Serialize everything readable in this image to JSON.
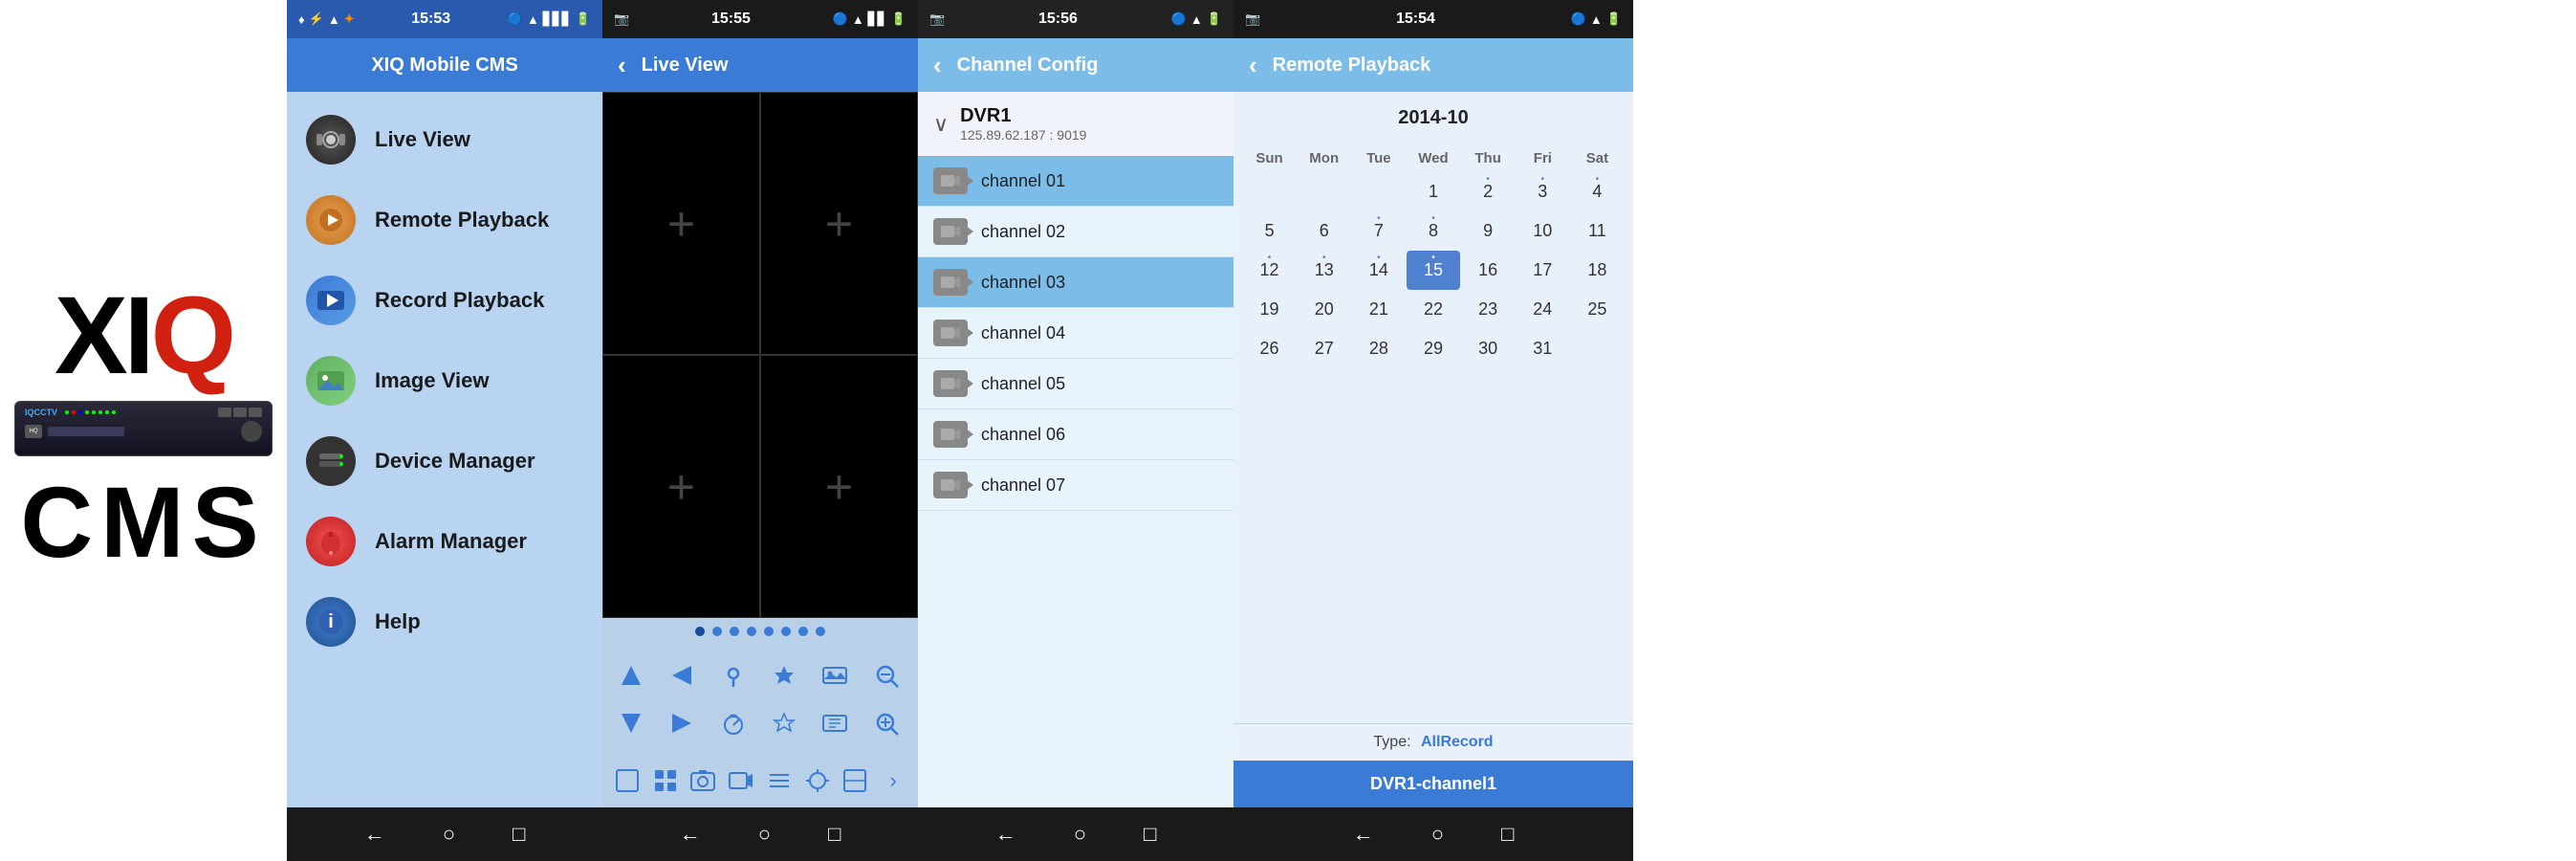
{
  "logo": {
    "xiq": "XIQ",
    "cms": "CMS",
    "x": "X",
    "i": "I",
    "q": "Q"
  },
  "phone2": {
    "statusBar": {
      "time": "15:53",
      "icons": "♦ ♦ ♦ ✦ ▲"
    },
    "header": "XIQ Mobile CMS",
    "menuItems": [
      {
        "label": "Live View",
        "iconType": "camera"
      },
      {
        "label": "Remote Playback",
        "iconType": "playback"
      },
      {
        "label": "Record Playback",
        "iconType": "record"
      },
      {
        "label": "Image View",
        "iconType": "image"
      },
      {
        "label": "Device Manager",
        "iconType": "device"
      },
      {
        "label": "Alarm Manager",
        "iconType": "alarm"
      },
      {
        "label": "Help",
        "iconType": "help"
      }
    ],
    "nav": [
      "←",
      "○",
      "□"
    ]
  },
  "phone3": {
    "statusBar": {
      "time": "15:55"
    },
    "header": "Live View",
    "dots": [
      1,
      2,
      3,
      4,
      5,
      6,
      7,
      8
    ],
    "activeDot": 0,
    "controls": [
      "▲",
      "◄",
      "📍",
      "◆",
      "▲",
      "⊙",
      "▼",
      "►",
      "⊙",
      "◆",
      "▲",
      "⊙"
    ],
    "toolbar": [
      "▭",
      "▯",
      "📷",
      "📹",
      "≡",
      "⊕",
      "▭",
      "→"
    ],
    "nav": [
      "←",
      "○",
      "□"
    ]
  },
  "phone4": {
    "statusBar": {
      "time": "15:56"
    },
    "header": "Channel Config",
    "dvrName": "DVR1",
    "dvrIp": "125.89.62.187 : 9019",
    "channels": [
      {
        "name": "channel 01",
        "highlighted": true
      },
      {
        "name": "channel 02",
        "highlighted": false
      },
      {
        "name": "channel 03",
        "highlighted": true
      },
      {
        "name": "channel 04",
        "highlighted": false
      },
      {
        "name": "channel 05",
        "highlighted": false
      },
      {
        "name": "channel 06",
        "highlighted": false
      },
      {
        "name": "channel 07",
        "highlighted": false
      }
    ],
    "nav": [
      "←",
      "○",
      "□"
    ]
  },
  "phone5": {
    "statusBar": {
      "time": "15:54"
    },
    "header": "Remote Playback",
    "calendarMonth": "2014-10",
    "calendarHeaders": [
      "Sun",
      "Mon",
      "Tue",
      "Wed",
      "Thu",
      "Fri",
      "Sat"
    ],
    "calendarRows": [
      [
        {
          "day": "",
          "empty": true,
          "dot": false
        },
        {
          "day": "",
          "empty": true,
          "dot": false
        },
        {
          "day": "",
          "empty": true,
          "dot": false
        },
        {
          "day": "1",
          "empty": false,
          "dot": false
        },
        {
          "day": "2",
          "empty": false,
          "dot": true
        },
        {
          "day": "3",
          "empty": false,
          "dot": true
        },
        {
          "day": "4",
          "empty": false,
          "dot": true
        }
      ],
      [
        {
          "day": "5",
          "empty": false,
          "dot": false
        },
        {
          "day": "6",
          "empty": false,
          "dot": false
        },
        {
          "day": "7",
          "empty": false,
          "dot": true
        },
        {
          "day": "8",
          "empty": false,
          "dot": true
        },
        {
          "day": "9",
          "empty": false,
          "dot": false
        },
        {
          "day": "10",
          "empty": false,
          "dot": false
        },
        {
          "day": "11",
          "empty": false,
          "dot": false
        }
      ],
      [
        {
          "day": "12",
          "empty": false,
          "dot": true
        },
        {
          "day": "13",
          "empty": false,
          "dot": true
        },
        {
          "day": "14",
          "empty": false,
          "dot": true
        },
        {
          "day": "15",
          "empty": false,
          "dot": true,
          "today": true
        },
        {
          "day": "16",
          "empty": false,
          "dot": false
        },
        {
          "day": "17",
          "empty": false,
          "dot": false
        },
        {
          "day": "18",
          "empty": false,
          "dot": false
        }
      ],
      [
        {
          "day": "19",
          "empty": false,
          "dot": false
        },
        {
          "day": "20",
          "empty": false,
          "dot": false
        },
        {
          "day": "21",
          "empty": false,
          "dot": false
        },
        {
          "day": "22",
          "empty": false,
          "dot": false
        },
        {
          "day": "23",
          "empty": false,
          "dot": false
        },
        {
          "day": "24",
          "empty": false,
          "dot": false
        },
        {
          "day": "25",
          "empty": false,
          "dot": false
        }
      ],
      [
        {
          "day": "26",
          "empty": false,
          "dot": false
        },
        {
          "day": "27",
          "empty": false,
          "dot": false
        },
        {
          "day": "28",
          "empty": false,
          "dot": false
        },
        {
          "day": "29",
          "empty": false,
          "dot": false
        },
        {
          "day": "30",
          "empty": false,
          "dot": false
        },
        {
          "day": "31",
          "empty": false,
          "dot": false
        },
        {
          "day": "",
          "empty": true,
          "dot": false
        }
      ]
    ],
    "typeLabel": "Type:",
    "typeValue": "AllRecord",
    "channelBtn": "DVR1-channel1",
    "nav": [
      "←",
      "○",
      "□"
    ]
  }
}
